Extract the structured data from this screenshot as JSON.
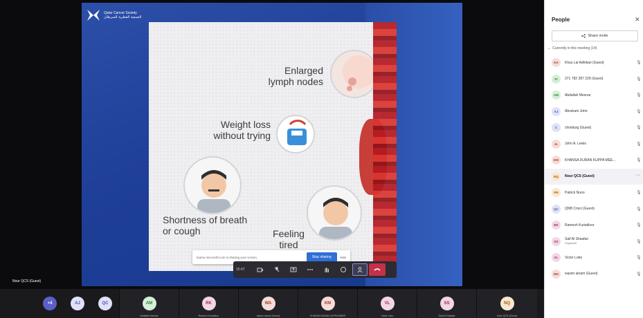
{
  "logo": {
    "line1": "Qatar Cancer Society",
    "line2": "الجمعية القطرية للسرطان"
  },
  "slide": {
    "lymph": "Enlarged lymph nodes",
    "weight": "Weight loss without trying",
    "shortness": "Shortness of breath or cough",
    "tired": "Feeling tired"
  },
  "banner": {
    "text": "teams.microsoft.com is sharing your screen.",
    "stop": "Stop sharing",
    "hide": "Hide"
  },
  "toolbar": {
    "time": "15:47"
  },
  "self_label": "Nour QCS (Guest)",
  "strip": [
    {
      "initials": "+4",
      "bg": "#5b5fc7",
      "fg": "#ffffff",
      "name": ""
    },
    {
      "initials": "AJ",
      "bg": "#dfe2f7",
      "fg": "#4f52b2",
      "name": ""
    },
    {
      "initials": "QC",
      "bg": "#dfe2f7",
      "fg": "#4f52b2",
      "name": ""
    },
    {
      "initials": "AM",
      "bg": "#d6efd8",
      "fg": "#2e7d32",
      "name": "Abdallah Mesnar"
    },
    {
      "initials": "RK",
      "bg": "#f3d6e6",
      "fg": "#9c2763",
      "name": "Ramesh Kuntalloor"
    },
    {
      "initials": "WA",
      "bg": "#f6dcd8",
      "fg": "#a33b2a",
      "name": "wasim akram (Guest)"
    },
    {
      "initials": "KM",
      "bg": "#f6dcd8",
      "fg": "#a33b2a",
      "name": "KHANSA DURAN KUPPA MEER"
    },
    {
      "initials": "VL",
      "bg": "#f3d6e6",
      "fg": "#9c2763",
      "name": "Victor Lobo"
    },
    {
      "initials": "SS",
      "bg": "#f3d6e6",
      "fg": "#9c2763",
      "name": "Saif Al Shaafan"
    },
    {
      "initials": "NQ",
      "bg": "#fbe7cf",
      "fg": "#a35b00",
      "name": "Nour QCS (Guest)"
    }
  ],
  "people": {
    "title": "People",
    "share_invite": "Share invite",
    "section": "Currently in this meeting (14)",
    "list": [
      {
        "initials": "KA",
        "bg": "#f6dcd8",
        "fg": "#a33b2a",
        "name": "Khus Lal Adhikari (Guest)",
        "role": "",
        "selected": false
      },
      {
        "initials": "37",
        "bg": "#d6efd8",
        "fg": "#2e7d32",
        "name": "371 782 287 229 (Guest)",
        "role": "",
        "selected": false
      },
      {
        "initials": "AM",
        "bg": "#d6efd8",
        "fg": "#2e7d32",
        "name": "Abdallah Mesnar",
        "role": "",
        "selected": false
      },
      {
        "initials": "AJ",
        "bg": "#dfe2f7",
        "fg": "#4f52b2",
        "name": "Abraham John",
        "role": "",
        "selected": false
      },
      {
        "initials": "C",
        "bg": "#dfe2f7",
        "fg": "#4f52b2",
        "name": "christlurg (Guest)",
        "role": "",
        "selected": false
      },
      {
        "initials": "JL",
        "bg": "#f6dcd8",
        "fg": "#a33b2a",
        "name": "John A. Lewis",
        "role": "",
        "selected": false
      },
      {
        "initials": "KM",
        "bg": "#f6dcd8",
        "fg": "#a33b2a",
        "name": "KHANSA DURAN KUPPA MEE...",
        "role": "",
        "selected": false
      },
      {
        "initials": "NQ",
        "bg": "#fbe7cf",
        "fg": "#a35b00",
        "name": "Nour QCS (Guest)",
        "role": "",
        "selected": true
      },
      {
        "initials": "PN",
        "bg": "#fbe7cf",
        "fg": "#a35b00",
        "name": "Patrick Nuno",
        "role": "",
        "selected": false
      },
      {
        "initials": "QC",
        "bg": "#dfe2f7",
        "fg": "#4f52b2",
        "name": "QNB Crisci (Guest)",
        "role": "",
        "selected": false
      },
      {
        "initials": "RK",
        "bg": "#f3d6e6",
        "fg": "#9c2763",
        "name": "Ramesh Kuntalloor",
        "role": "",
        "selected": false
      },
      {
        "initials": "SS",
        "bg": "#f3d6e6",
        "fg": "#9c2763",
        "name": "Saif Al Shaafan",
        "role": "Organizer",
        "selected": false
      },
      {
        "initials": "VL",
        "bg": "#f3d6e6",
        "fg": "#9c2763",
        "name": "Victor Lobo",
        "role": "",
        "selected": false
      },
      {
        "initials": "WA",
        "bg": "#f6dcd8",
        "fg": "#a33b2a",
        "name": "wasim akram (Guest)",
        "role": "",
        "selected": false
      }
    ]
  }
}
